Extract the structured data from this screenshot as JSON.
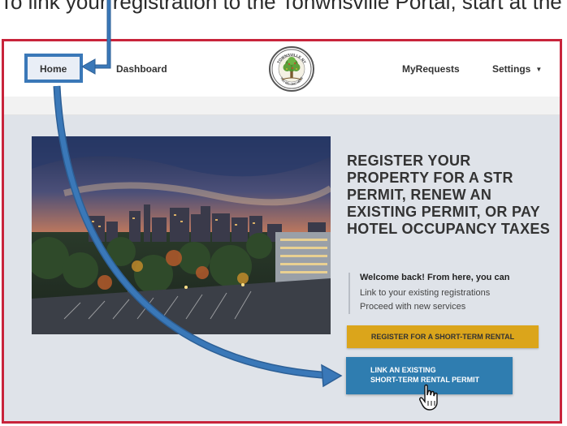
{
  "caption": {
    "text": "To link your registration to the Tonwnsville Portal, start at the Home Page and click the following"
  },
  "nav": {
    "home_label": "Home",
    "dashboard_label": "Dashboard",
    "myrequests_label": "MyRequests",
    "settings_label": "Settings",
    "settings_caret": "▼"
  },
  "logo": {
    "top_text": "TOWNSVILLE NY",
    "bottom_text": "YOU BELONG HERE"
  },
  "hero": {
    "headline": "REGISTER YOUR PROPERTY FOR A STR PERMIT, RENEW AN EXISTING PERMIT, OR PAY HOTEL OCCUPANCY TAXES",
    "welcome_title": "Welcome back! From here, you can",
    "welcome_line1": "Link to your existing registrations",
    "welcome_line2": "Proceed with new services"
  },
  "buttons": {
    "register_label": "REGISTER FOR A SHORT-TERM RENTAL",
    "link_line1": "LINK AN EXISTING",
    "link_line2": "SHORT-TERM RENTAL PERMIT"
  },
  "colors": {
    "frame_border": "#c8243b",
    "annotation_blue": "#3a78b8",
    "register_button": "#dba51b",
    "link_button": "#2f7db0",
    "page_background": "#dfe3e9"
  }
}
